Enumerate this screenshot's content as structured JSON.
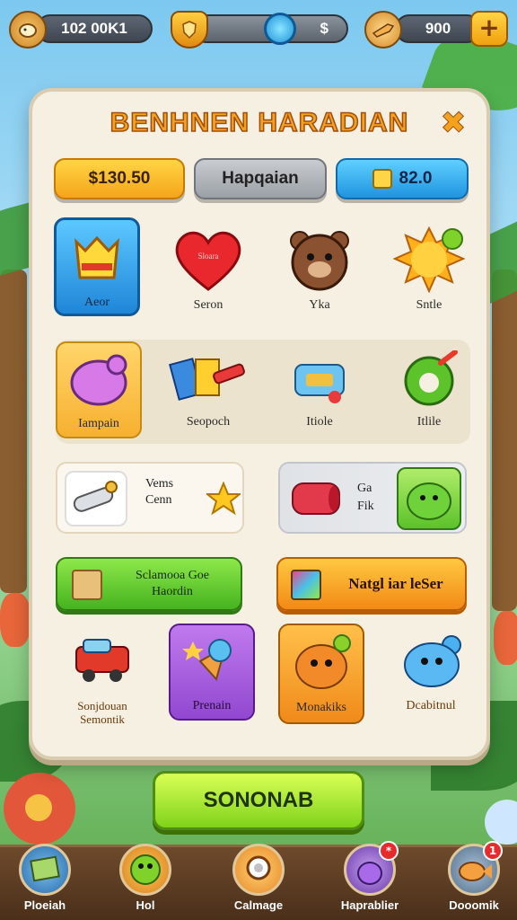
{
  "hud": {
    "coins": "102 00K1",
    "progress_value": "$",
    "energy": "900",
    "add_label": "+"
  },
  "panel": {
    "title": "BENHNEN HARADIAN",
    "close_label": "✖"
  },
  "top_buttons": {
    "price": "$130.50",
    "middle": "Hapqaian",
    "gems": "82.0"
  },
  "row1": [
    {
      "label": "Aeor",
      "icon": "crown-banner-icon"
    },
    {
      "label": "Seron",
      "icon": "heart-icon",
      "caption": "Sloara"
    },
    {
      "label": "Yka",
      "icon": "bear-icon"
    },
    {
      "label": "Sntle",
      "icon": "sun-icon"
    }
  ],
  "row2": [
    {
      "label": "Iampain",
      "icon": "piggy-icon"
    },
    {
      "label": "Seopoch",
      "icon": "cards-icon"
    },
    {
      "label": "Itiole",
      "icon": "machine-icon"
    },
    {
      "label": "Itlile",
      "icon": "ring-icon"
    }
  ],
  "row3": {
    "scroll_text_1": "Vems",
    "scroll_text_2": "Cenn",
    "card_text_1": "Ga",
    "card_text_2": "Fik"
  },
  "action_buttons": {
    "green_line1": "Sclamooa Goe",
    "green_line2": "Haordin",
    "orange": "Natgl iar leSer"
  },
  "row4": [
    {
      "label_line1": "Sonjdouan",
      "label_line2": "Semontik",
      "icon": "truck-icon"
    },
    {
      "label": "Prenain",
      "icon": "icecream-icon"
    },
    {
      "label": "Monakiks",
      "icon": "orange-monster-icon"
    },
    {
      "label": "Dcabitnul",
      "icon": "blue-creature-icon"
    }
  ],
  "main_button": "SONONAB",
  "bottom_nav": [
    {
      "label": "Ploeiah",
      "icon": "map-icon"
    },
    {
      "label": "Hol",
      "icon": "green-monster-icon"
    },
    {
      "label": "Calmage",
      "icon": "location-icon"
    },
    {
      "label": "Haprablier",
      "icon": "potion-icon",
      "badge": "*"
    },
    {
      "label": "Dooomik",
      "icon": "fish-icon",
      "badge": "1"
    }
  ]
}
